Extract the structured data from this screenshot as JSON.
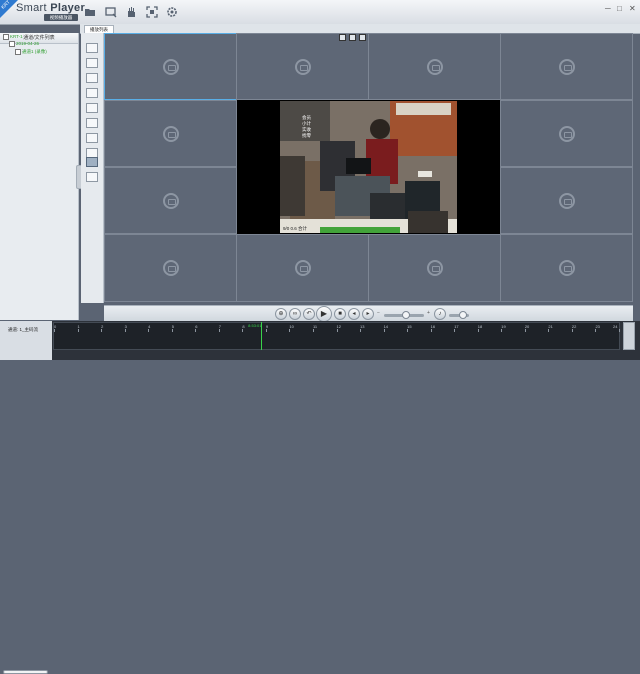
{
  "app": {
    "badge": "KRT",
    "title_regular": "Smart ",
    "title_bold": "Player",
    "subtitle": "视频播放器"
  },
  "toolbar": {
    "icons": [
      "folder-icon",
      "snapshot-icon",
      "hand-icon",
      "fullscreen-icon",
      "settings-icon"
    ]
  },
  "left_panel": {
    "header": "通道/文件列表",
    "tree": [
      {
        "label": "KRT-1",
        "level": 0
      },
      {
        "label": "2019-04-26",
        "level": 1
      },
      {
        "label": "通道1 (录像)",
        "level": 2
      }
    ]
  },
  "tabs": [
    {
      "label": "播放列表"
    }
  ],
  "grid": {
    "rows": 4,
    "cols": 4,
    "selected_cell": 0,
    "active_video_cell": "center-2x2"
  },
  "video": {
    "overlay_lines": [
      "会员",
      "小计",
      "实收",
      "找零"
    ],
    "bottom_text": "9/0 0.6 合计"
  },
  "transport": {
    "buttons": [
      "zoom-icon",
      "loop-icon",
      "rewind-icon",
      "play-icon",
      "stop-icon",
      "slow-icon",
      "fast-icon"
    ],
    "speed_position": 0.55,
    "volume_position": 0.7
  },
  "timeline": {
    "info": "通道: 1_主码流",
    "hours": [
      "0",
      "1",
      "2",
      "3",
      "4",
      "5",
      "6",
      "7",
      "8",
      "9",
      "10",
      "11",
      "12",
      "13",
      "14",
      "15",
      "16",
      "17",
      "18",
      "19",
      "20",
      "21",
      "22",
      "23",
      "24"
    ],
    "cursor_hour": 8.8,
    "cursor_label": "8:53:01"
  },
  "colors": {
    "accent_blue": "#2f7ad0",
    "cursor_green": "#39d34a",
    "cell_bg": "#5e6776"
  }
}
